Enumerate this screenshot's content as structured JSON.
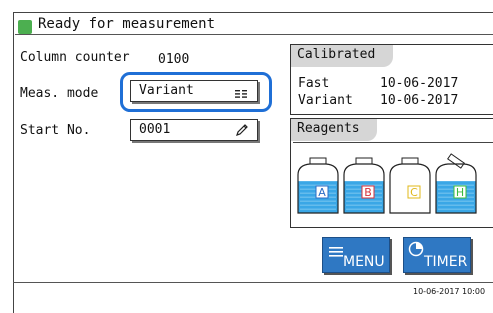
{
  "status": {
    "title": "Ready for measurement",
    "indicator_color": "#4caf50"
  },
  "left": {
    "column_counter_label": "Column counter",
    "column_counter_value": "0100",
    "meas_mode_label": "Meas. mode",
    "meas_mode_value": "Variant",
    "start_no_label": "Start No.",
    "start_no_value": "0001"
  },
  "calibrated": {
    "header": "Calibrated",
    "rows": [
      {
        "name": "Fast",
        "date": "10-06-2017"
      },
      {
        "name": "Variant",
        "date": "10-06-2017"
      }
    ]
  },
  "reagents": {
    "header": "Reagents",
    "bottles": [
      {
        "label": "A",
        "label_color": "#2b6cc4",
        "fill_fraction": 0.65
      },
      {
        "label": "B",
        "label_color": "#d9313a",
        "fill_fraction": 0.65
      },
      {
        "label": "C",
        "label_color": "#e0b81a",
        "fill_fraction": 0.0
      },
      {
        "label": "H",
        "label_color": "#3dbb3d",
        "fill_fraction": 0.65
      }
    ]
  },
  "buttons": {
    "menu_label": "MENU",
    "timer_label": "TIMER"
  },
  "footer": {
    "datetime": "10-06-2017 10:00"
  },
  "colors": {
    "accent": "#2f78c3",
    "highlight": "#1f6fd6",
    "liquid": "#3aa7e6"
  }
}
